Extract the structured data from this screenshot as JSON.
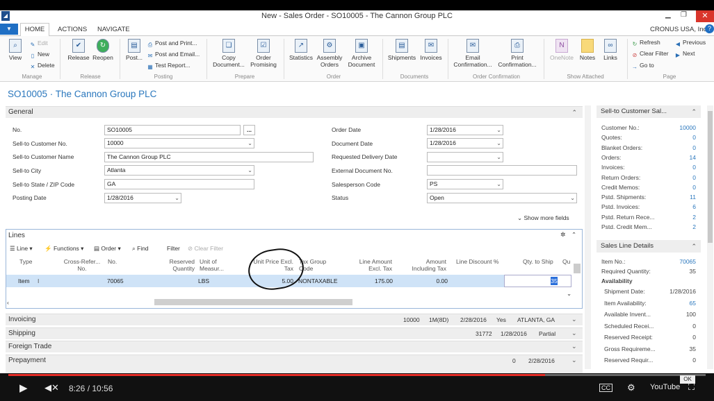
{
  "window": {
    "title": "New - Sales Order - SO10005 - The Cannon Group PLC",
    "company": "CRONUS USA, Inc."
  },
  "tabs": [
    "HOME",
    "ACTIONS",
    "NAVIGATE"
  ],
  "ribbon": {
    "manage": {
      "group": "Manage",
      "view": "View",
      "edit": "Edit",
      "new": "New",
      "delete": "Delete"
    },
    "release": {
      "group": "Release",
      "release": "Release",
      "reopen": "Reopen"
    },
    "posting": {
      "group": "Posting",
      "post": "Post...",
      "post_print": "Post and Print...",
      "post_email": "Post and Email...",
      "test_report": "Test Report..."
    },
    "prepare": {
      "group": "Prepare",
      "copy": "Copy Document...",
      "promising": "Order Promising"
    },
    "order": {
      "group": "Order",
      "statistics": "Statistics",
      "assembly": "Assembly Orders",
      "archive": "Archive Document"
    },
    "documents": {
      "group": "Documents",
      "shipments": "Shipments",
      "invoices": "Invoices"
    },
    "confirmation": {
      "group": "Order Confirmation",
      "email": "Email Confirmation...",
      "print": "Print Confirmation..."
    },
    "attached": {
      "group": "Show Attached",
      "onenote": "OneNote",
      "notes": "Notes",
      "links": "Links"
    },
    "page": {
      "group": "Page",
      "refresh": "Refresh",
      "clear_filter": "Clear Filter",
      "goto": "Go to",
      "previous": "Previous",
      "next": "Next"
    }
  },
  "page_title": "SO10005 · The Cannon Group PLC",
  "general": {
    "title": "General",
    "no_label": "No.",
    "no": "SO10005",
    "assist": "...",
    "cust_no_label": "Sell-to Customer No.",
    "cust_no": "10000",
    "cust_name_label": "Sell-to Customer Name",
    "cust_name": "The Cannon Group PLC",
    "city_label": "Sell-to City",
    "city": "Atlanta",
    "state_label": "Sell-to State / ZIP Code",
    "state": "GA",
    "posting_label": "Posting Date",
    "posting": "1/28/2016",
    "order_date_label": "Order Date",
    "order_date": "1/28/2016",
    "doc_date_label": "Document Date",
    "doc_date": "1/28/2016",
    "req_date_label": "Requested Delivery Date",
    "req_date": "",
    "ext_doc_label": "External Document No.",
    "ext_doc": "",
    "sp_label": "Salesperson Code",
    "sp": "PS",
    "status_label": "Status",
    "status": "Open",
    "more": "Show more fields"
  },
  "lines": {
    "title": "Lines",
    "toolbar": {
      "line": "Line",
      "functions": "Functions",
      "order": "Order",
      "find": "Find",
      "filter": "Filter",
      "clear": "Clear Filter"
    },
    "headers": {
      "type": "Type",
      "cross_ref": "Cross-Refer... No.",
      "no": "No.",
      "reserved": "Reserved Quantity",
      "uom": "Unit of Measur...",
      "unit_price": "Unit Price Excl. Tax",
      "tax_group": "Tax Group Code",
      "line_amount": "Line Amount Excl. Tax",
      "amount_incl": "Amount Including Tax",
      "discount": "Line Discount %",
      "qty_ship": "Qty. to Ship",
      "qu": "Qu"
    },
    "row": {
      "type": "Item",
      "no": "70065",
      "uom": "LBS",
      "unit_price": "5.00",
      "tax_group": "NONTAXABLE",
      "line_amount": "175.00",
      "amount_incl": "0.00",
      "qty_ship": "35"
    }
  },
  "fasttabs": {
    "invoicing": {
      "title": "Invoicing",
      "v1": "10000",
      "v2": "1M(8D)",
      "v3": "2/28/2016",
      "v4": "Yes",
      "v5": "ATLANTA, GA"
    },
    "shipping": {
      "title": "Shipping",
      "v1": "31772",
      "v2": "1/28/2016",
      "v3": "Partial"
    },
    "foreign": {
      "title": "Foreign Trade"
    },
    "prepayment": {
      "title": "Prepayment",
      "v1": "0",
      "v2": "2/28/2016"
    }
  },
  "factbox_customer": {
    "title": "Sell-to Customer Sal...",
    "rows": [
      {
        "label": "Customer No.:",
        "value": "10000"
      },
      {
        "label": "Quotes:",
        "value": "0"
      },
      {
        "label": "Blanket Orders:",
        "value": "0"
      },
      {
        "label": "Orders:",
        "value": "14"
      },
      {
        "label": "Invoices:",
        "value": "0"
      },
      {
        "label": "Return Orders:",
        "value": "0"
      },
      {
        "label": "Credit Memos:",
        "value": "0"
      },
      {
        "label": "Pstd. Shipments:",
        "value": "11"
      },
      {
        "label": "Pstd. Invoices:",
        "value": "6"
      },
      {
        "label": "Pstd. Return Rece...",
        "value": "2"
      },
      {
        "label": "Pstd. Credit Mem...",
        "value": "2"
      }
    ]
  },
  "factbox_line": {
    "title": "Sales Line Details",
    "item_label": "Item No.:",
    "item": "70065",
    "req_label": "Required Quantity:",
    "req": "35",
    "avail": "Availability",
    "rows": [
      {
        "label": "Shipment Date:",
        "value": "1/28/2016"
      },
      {
        "label": "Item Availability:",
        "value": "65"
      },
      {
        "label": "Available Invent...",
        "value": "100"
      },
      {
        "label": "Scheduled Recei...",
        "value": "0"
      },
      {
        "label": "Reserved Receipt:",
        "value": "0"
      },
      {
        "label": "Gross Requireme...",
        "value": "35"
      },
      {
        "label": "Reserved Requir...",
        "value": "0"
      }
    ]
  },
  "player": {
    "time": "8:26 / 10:56",
    "progress": 0.77,
    "ok": "OK",
    "youtube": "YouTube"
  }
}
